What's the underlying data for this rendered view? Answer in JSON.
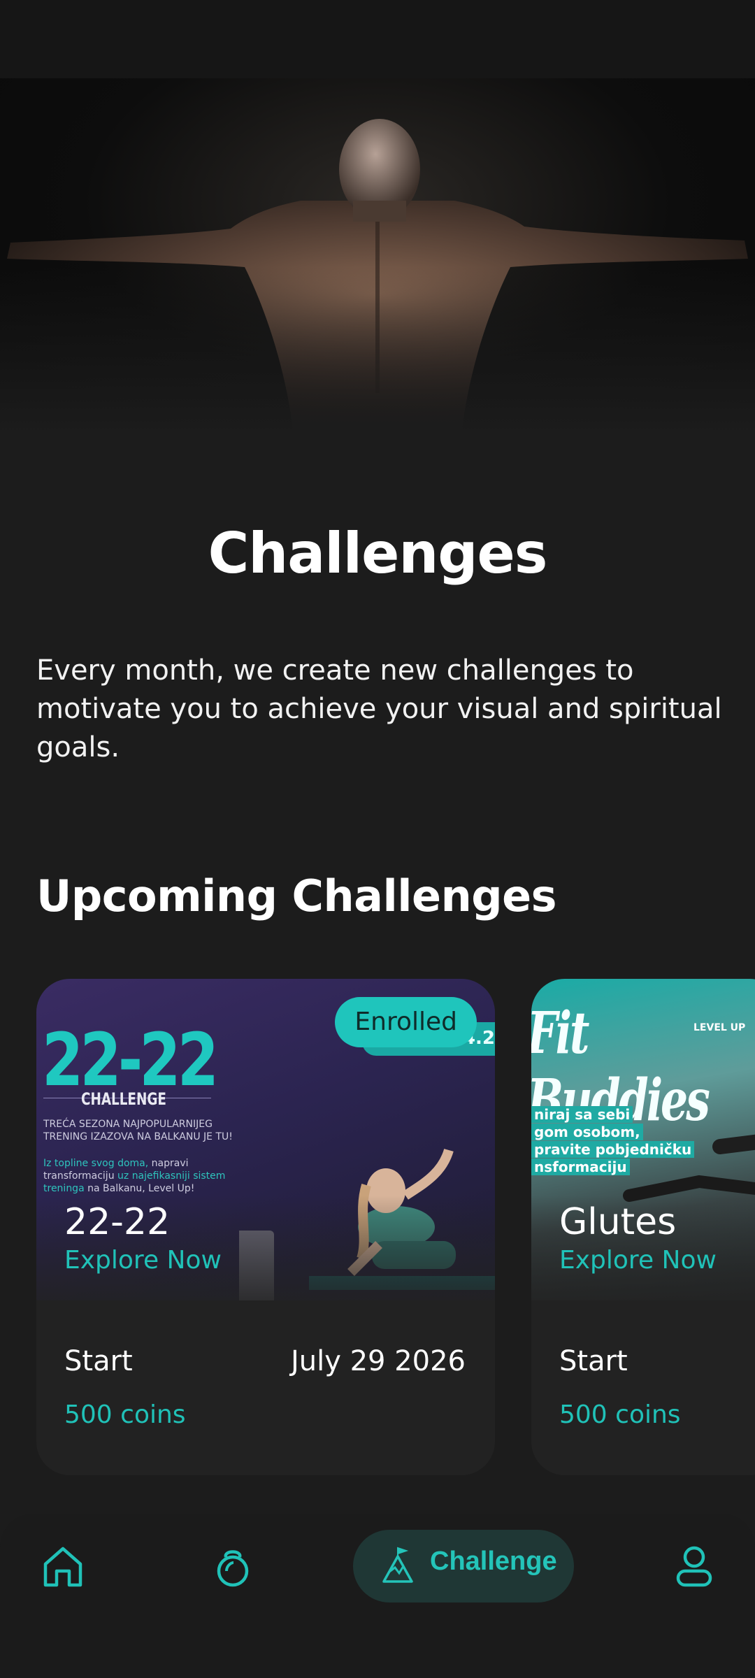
{
  "header": {
    "title": "Challenges",
    "description": "Every month, we create new challenges to motivate you to achieve your visual and spiritual goals."
  },
  "upcoming": {
    "section_title": "Upcoming Challenges",
    "cards": [
      {
        "name": "22-22",
        "link_label": "Explore Now",
        "badge": "Enrolled",
        "badge_tail_text": ".4.2",
        "poster": {
          "big": "22-22",
          "sub": "CHALLENGE",
          "line1": "TREĆA SEZONA NAJPOPULARNIJEG",
          "line2": "TRENING IZAZOVA NA BALKANU JE TU!",
          "line3a": "Iz topline svog doma,",
          "line3b": "napravi",
          "line4a": "transformaciju",
          "line4b": "uz najefikasniji sistem",
          "line5a": "treninga",
          "line5b": "na Balkanu, Level Up!"
        },
        "start_label": "Start",
        "start_date": "July 29 2026",
        "price": "500 coins"
      },
      {
        "name": "Glutes",
        "link_label": "Explore Now",
        "poster": {
          "title": "Fit Buddies",
          "level": "LEVEL UP",
          "line1": "niraj sa sebi",
          "line2": "gom osobom,",
          "line3": "pravite pobjedničku",
          "line4": "nsformaciju"
        },
        "start_label": "Start",
        "price": "500 coins"
      }
    ]
  },
  "nav": {
    "active_label": "Challenge",
    "items": [
      "home-icon",
      "kettlebell-icon",
      "challenge-flag-icon",
      "profile-icon"
    ]
  },
  "colors": {
    "background": "#1c1c1c",
    "accent": "#20c2b8",
    "card": "#222222"
  }
}
